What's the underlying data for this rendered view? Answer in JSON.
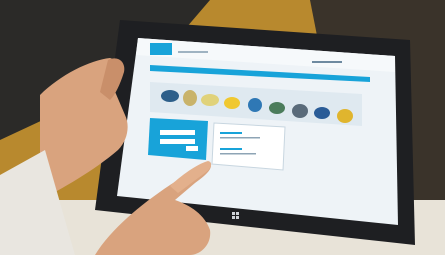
{
  "photo": {
    "subject": "tablet-with-login-page",
    "colors": {
      "background_wood": "#b8892e",
      "background_dark": "#2b2a28",
      "tablet_frame": "#1e1f22",
      "screen_bg": "#eef3f7",
      "brand_blue": "#18a3d9",
      "skin": "#d9a37e",
      "sleeve": "#e9e6e0"
    }
  },
  "icons": {
    "logo": "brand-logo-badge",
    "windows_button": "windows-logo-icon"
  }
}
